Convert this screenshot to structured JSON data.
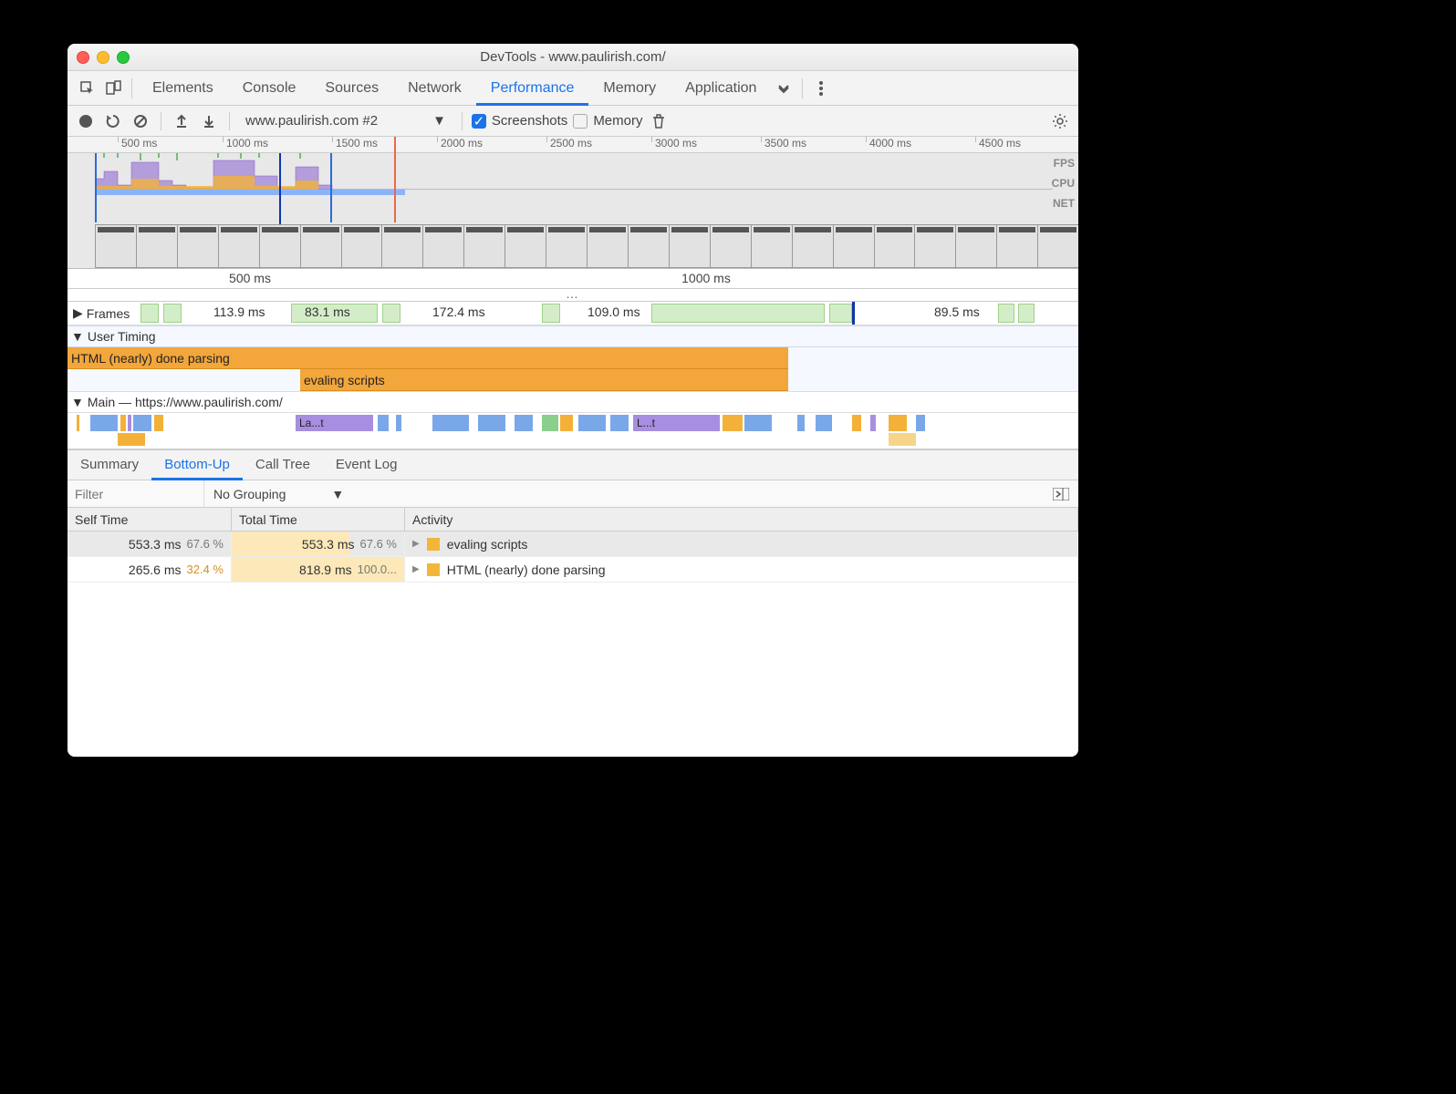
{
  "window": {
    "title": "DevTools - www.paulirish.com/"
  },
  "tabs": [
    "Elements",
    "Console",
    "Sources",
    "Network",
    "Performance",
    "Memory",
    "Application"
  ],
  "tabs_active": "Performance",
  "toolbar": {
    "profile_label": "www.paulirish.com #2",
    "screenshots_label": "Screenshots",
    "screenshots_checked": true,
    "memory_label": "Memory",
    "memory_checked": false
  },
  "overview": {
    "ticks": [
      "500 ms",
      "1000 ms",
      "1500 ms",
      "2000 ms",
      "2500 ms",
      "3000 ms",
      "3500 ms",
      "4000 ms",
      "4500 ms"
    ],
    "right_labels": [
      "FPS",
      "CPU",
      "NET"
    ]
  },
  "track_ruler": [
    "500 ms",
    "1000 ms"
  ],
  "frames": {
    "label": "Frames",
    "values": [
      "113.9 ms",
      "83.1 ms",
      "172.4 ms",
      "109.0 ms",
      "89.5 ms"
    ]
  },
  "user_timing": {
    "label": "User Timing",
    "bars": [
      "HTML (nearly) done parsing",
      "evaling scripts"
    ]
  },
  "main": {
    "label": "Main — https://www.paulirish.com/",
    "slice_labels": [
      "La...t",
      "L...t"
    ]
  },
  "detail_tabs": [
    "Summary",
    "Bottom-Up",
    "Call Tree",
    "Event Log"
  ],
  "detail_tabs_active": "Bottom-Up",
  "filter": {
    "placeholder": "Filter",
    "grouping": "No Grouping"
  },
  "table": {
    "headers": [
      "Self Time",
      "Total Time",
      "Activity"
    ],
    "rows": [
      {
        "self": "553.3 ms",
        "self_pct": "67.6 %",
        "total": "553.3 ms",
        "total_pct": "67.6 %",
        "activity": "evaling scripts",
        "selected": true,
        "bar": "p68"
      },
      {
        "self": "265.6 ms",
        "self_pct": "32.4 %",
        "self_pct_orange": true,
        "total": "818.9 ms",
        "total_pct": "100.0...",
        "activity": "HTML (nearly) done parsing",
        "selected": false,
        "bar": "p100"
      }
    ]
  }
}
